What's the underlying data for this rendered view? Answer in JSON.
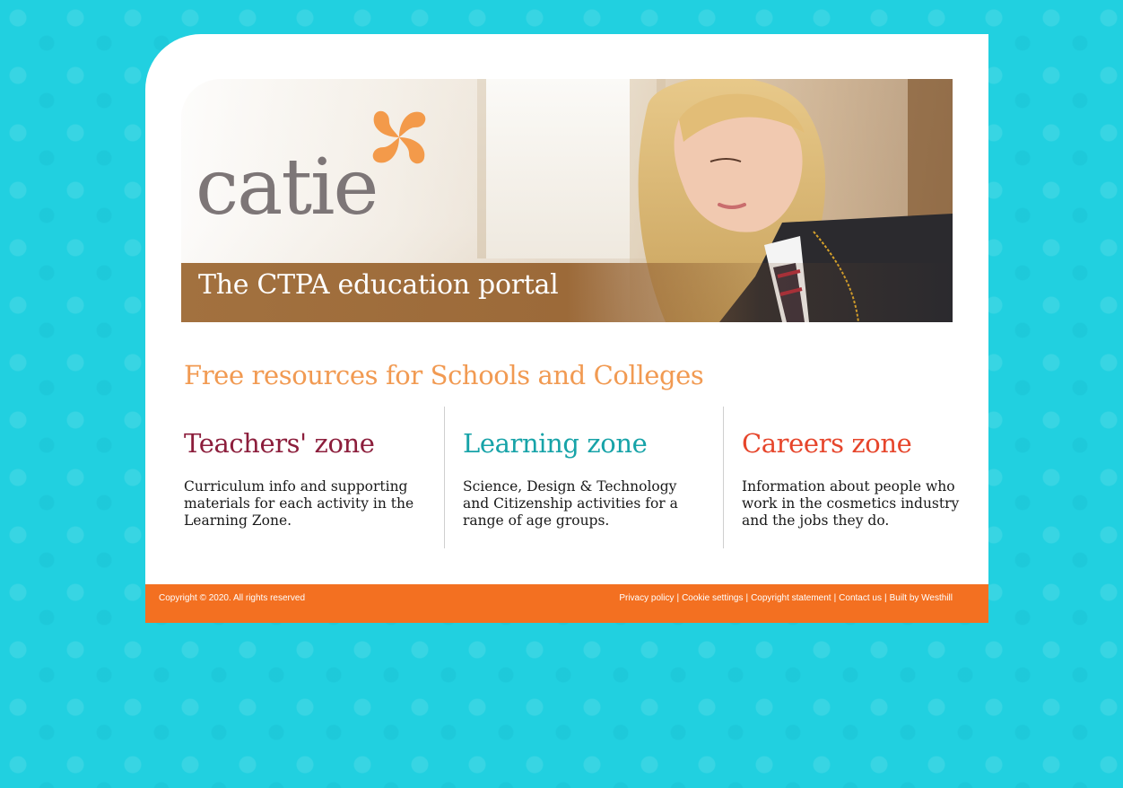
{
  "brand": {
    "logo_text": "catie",
    "tagline": "The CTPA education portal",
    "colors": {
      "orange": "#f37021",
      "background": "#21d0e0",
      "logo_gray": "#7d7677"
    }
  },
  "headline": "Free resources for Schools and Colleges",
  "zones": [
    {
      "title": "Teachers' zone",
      "description": "Curriculum info and supporting materials for each activity in the Learning Zone.",
      "color": "#8c1e3c"
    },
    {
      "title": "Learning zone",
      "description": "Science, Design & Technology and Citizenship activities for a range of age groups.",
      "color": "#17a3a8"
    },
    {
      "title": "Careers zone",
      "description": "Information about people who work in the cosmetics industry and the jobs they do.",
      "color": "#e6452b"
    }
  ],
  "footer": {
    "copyright": "Copyright © 2020. All rights reserved",
    "links": [
      "Privacy policy",
      "Cookie settings",
      "Copyright statement",
      "Contact us",
      "Built by Westhill"
    ],
    "separator": "|"
  }
}
